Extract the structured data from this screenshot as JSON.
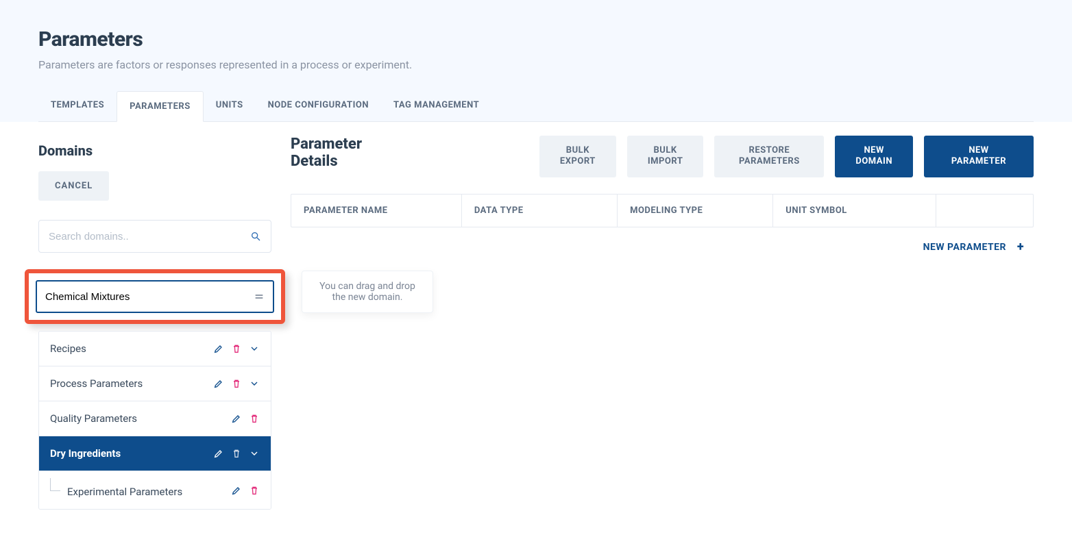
{
  "header": {
    "title": "Parameters",
    "subtitle": "Parameters are factors or responses represented in a process or experiment."
  },
  "tabs": {
    "items": [
      {
        "label": "TEMPLATES"
      },
      {
        "label": "PARAMETERS"
      },
      {
        "label": "UNITS"
      },
      {
        "label": "NODE CONFIGURATION"
      },
      {
        "label": "TAG MANAGEMENT"
      }
    ],
    "active_index": 1
  },
  "left": {
    "domains_title": "Domains",
    "cancel_label": "CANCEL",
    "search_placeholder": "Search domains..",
    "new_domain_value": "Chemical Mixtures",
    "domain_items": [
      {
        "label": "Recipes",
        "has_expand": true
      },
      {
        "label": "Process Parameters",
        "has_expand": true
      },
      {
        "label": "Quality Parameters",
        "has_expand": false
      },
      {
        "label": "Dry Ingredients",
        "has_expand": true,
        "selected": true
      },
      {
        "label": "Experimental Parameters",
        "has_expand": false,
        "nested": true
      }
    ]
  },
  "right": {
    "details_title": "Parameter Details",
    "buttons": {
      "bulk_export": "BULK\nEXPORT",
      "bulk_import": "BULK\nIMPORT",
      "restore_parameters": "RESTORE\nPARAMETERS",
      "new_domain": "NEW\nDOMAIN",
      "new_parameter": "NEW\nPARAMETER"
    },
    "columns": {
      "parameter_name": "PARAMETER NAME",
      "data_type": "DATA TYPE",
      "modeling_type": "MODELING TYPE",
      "unit_symbol": "UNIT SYMBOL"
    },
    "new_parameter_link": "NEW PARAMETER"
  },
  "tooltip": {
    "text": "You can drag and drop the new domain."
  }
}
